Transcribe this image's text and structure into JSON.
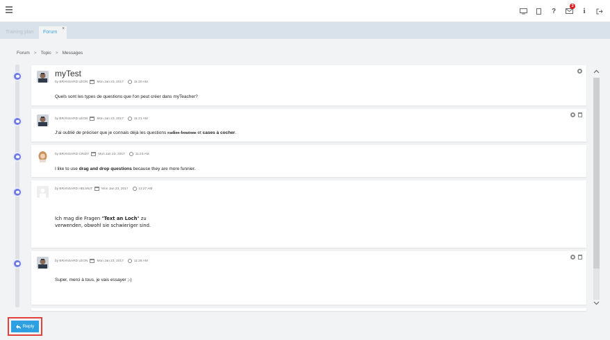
{
  "topbar": {
    "icons": [
      "desktop-icon",
      "tablet-icon",
      "help-icon",
      "mail-icon",
      "info-icon",
      "logout-icon"
    ],
    "notification_count": "3",
    "help_glyph": "?",
    "info_glyph": "i"
  },
  "tabs": [
    {
      "label": "Training plan"
    },
    {
      "label": "Forum",
      "close": "×"
    }
  ],
  "breadcrumb": {
    "items": [
      "Forum",
      "Topic",
      "Messages"
    ],
    "separator": ">"
  },
  "thread": {
    "title": "myTest",
    "posts": [
      {
        "author": "by BRANSARD LÉON",
        "date": "Mon Jan 23, 2017",
        "time": "11:20 AM",
        "parts": [
          "Quels sont les types de questions que l'on peut créer dans myTeacher?"
        ]
      },
      {
        "author": "by BRANSARD LÉON",
        "date": "Mon Jan 23, 2017",
        "time": "11:21 AM",
        "parts": [
          "J'ai oublié de préciser que je connais déjà les questions ",
          "radios-boutons",
          " et ",
          "cases à cocher",
          "."
        ]
      },
      {
        "author": "by BRANSARD CINDY",
        "date": "Mon Jan 23, 2017",
        "time": "11:23 AM",
        "parts": [
          "I like to use ",
          "drag and drop questions",
          " because they are more funnier."
        ]
      },
      {
        "author": "by BRANSARD HELMUT",
        "date": "Mon Jan 23, 2017",
        "time": "11:27 AM",
        "parts": [
          "Ich mag die Fragen \"",
          "Text an Loch",
          "\" zu",
          "verwenden, obwohl sie schwieriger sind."
        ]
      },
      {
        "author": "by BRANSARD LÉON",
        "date": "Mon Jan 23, 2017",
        "time": "11:28 AM",
        "parts": [
          "Super, merci à tous, je vais essayer ;-)"
        ]
      }
    ]
  },
  "reply": {
    "label": "Reply"
  },
  "colors": {
    "accent": "#2ea0e2",
    "timeline_dot": "#6f7ce0",
    "highlight": "#e0413a",
    "badge": "#e0171c"
  }
}
